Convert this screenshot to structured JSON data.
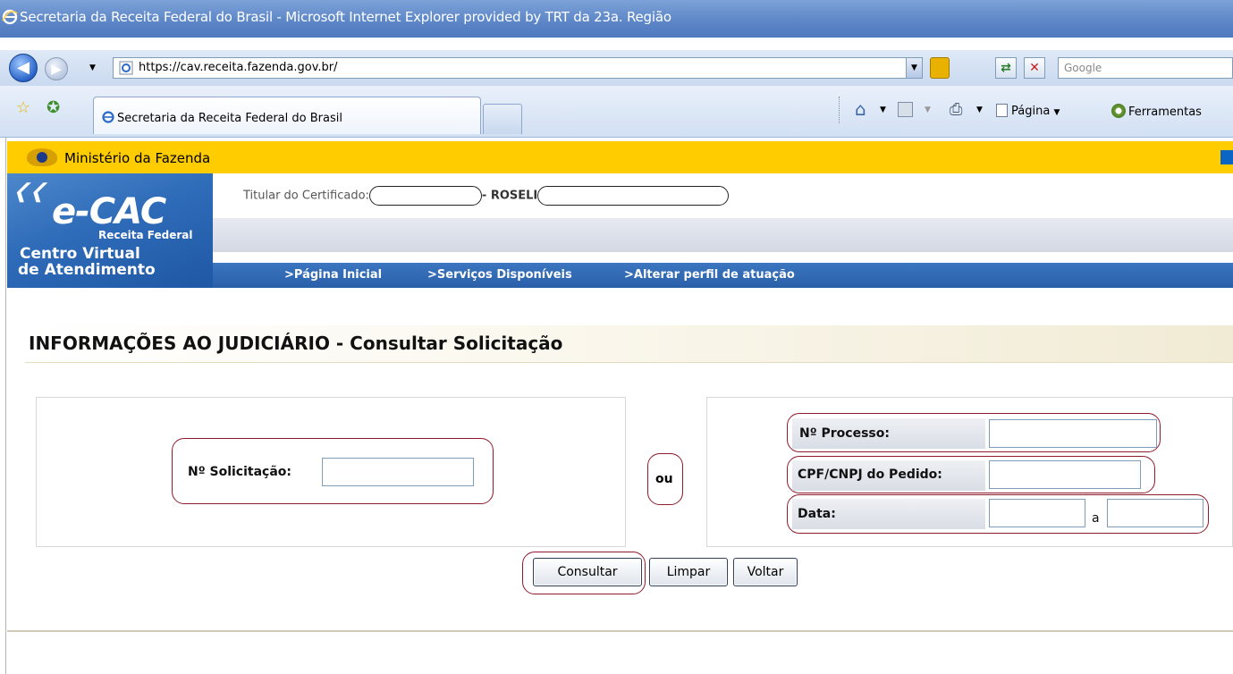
{
  "window": {
    "title": "Secretaria da Receita Federal do Brasil - Microsoft Internet Explorer provided by TRT da 23a. Região"
  },
  "browser": {
    "url": "https://cav.receita.fazenda.gov.br/",
    "search_placeholder": "Google",
    "tab_label": "Secretaria da Receita Federal do Brasil",
    "commands": {
      "page_label": "Página",
      "tools_label": "Ferramentas"
    }
  },
  "site": {
    "ministry": "Ministério da Fazenda",
    "brand": {
      "logo_text": "e-CAC",
      "subtitle": "Receita Federal",
      "line1": "Centro Virtual",
      "line2": "de Atendimento"
    },
    "titular_label": "Titular do Certificado:",
    "titular_sep": "- ROSELI",
    "nav": [
      ">Página Inicial",
      ">Serviços Disponíveis",
      ">Alterar perfil de atuação"
    ]
  },
  "main": {
    "section_title": "INFORMAÇÕES AO JUDICIÁRIO - Consultar Solicitação",
    "left": {
      "solicitacao_label": "Nº Solicitação:",
      "solicitacao_value": ""
    },
    "or_label": "ou",
    "right": {
      "processo_label": "Nº Processo:",
      "processo_value": "",
      "cpf_label": "CPF/CNPJ do Pedido:",
      "cpf_value": "",
      "data_label": "Data:",
      "data_from": "",
      "data_sep": "a",
      "data_to": ""
    },
    "buttons": {
      "consultar": "Consultar",
      "limpar": "Limpar",
      "voltar": "Voltar"
    }
  },
  "colors": {
    "ministry_bar": "#ffcc00",
    "brand_blue": "#2e6bb8",
    "highlight_oval": "#8e1b2c"
  }
}
